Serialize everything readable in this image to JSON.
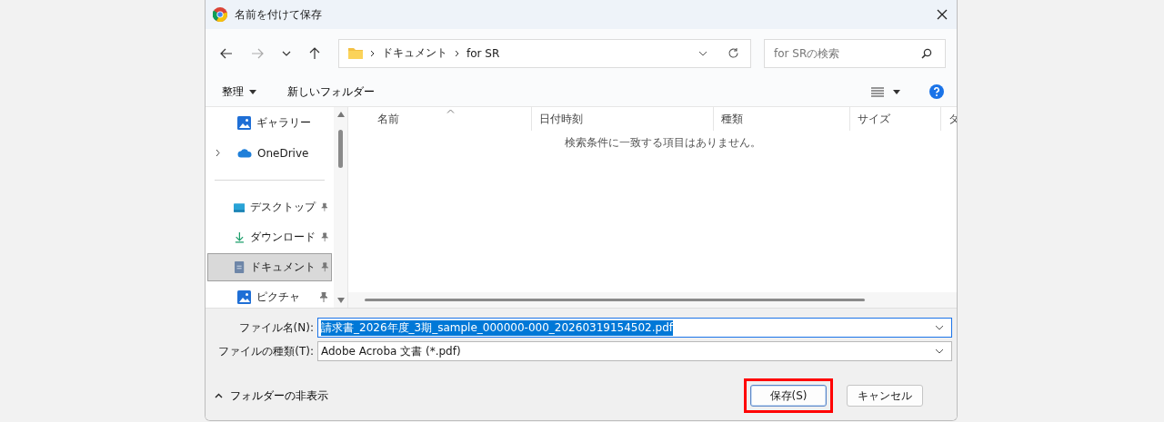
{
  "window": {
    "title": "名前を付けて保存"
  },
  "nav": {
    "path": [
      "ドキュメント",
      "for SR"
    ],
    "search": {
      "placeholder": "for SRの検索"
    }
  },
  "toolbar": {
    "organize": "整理",
    "new_folder": "新しいフォルダー"
  },
  "sidebar": {
    "groups": [
      [
        {
          "label": "ギャラリー",
          "kind": "gallery",
          "expandable": false,
          "pinned": false,
          "selected": false
        },
        {
          "label": "OneDrive",
          "kind": "cloud",
          "expandable": true,
          "pinned": false,
          "selected": false
        }
      ],
      [
        {
          "label": "デスクトップ",
          "kind": "desktop",
          "expandable": false,
          "pinned": true,
          "selected": false
        },
        {
          "label": "ダウンロード",
          "kind": "download",
          "expandable": false,
          "pinned": true,
          "selected": false
        },
        {
          "label": "ドキュメント",
          "kind": "document",
          "expandable": false,
          "pinned": true,
          "selected": true
        },
        {
          "label": "ピクチャ",
          "kind": "gallery",
          "expandable": false,
          "pinned": true,
          "selected": false
        }
      ]
    ]
  },
  "table": {
    "columns": [
      "名前",
      "日付時刻",
      "種類",
      "サイズ",
      "タ"
    ],
    "empty_message": "検索条件に一致する項目はありません。"
  },
  "file_name": {
    "label": "ファイル名(N):",
    "value": "請求書_2026年度_3期_sample_000000-000_20260319154502.pdf"
  },
  "file_type": {
    "label": "ファイルの種類(T):",
    "value": "Adobe Acroba 文書 (*.pdf)"
  },
  "hide_folders": "フォルダーの非表示",
  "buttons": [
    {
      "label": "保存(S)",
      "highlighted": true,
      "primary": true
    },
    {
      "label": "キャンセル",
      "highlighted": false,
      "primary": false
    }
  ]
}
